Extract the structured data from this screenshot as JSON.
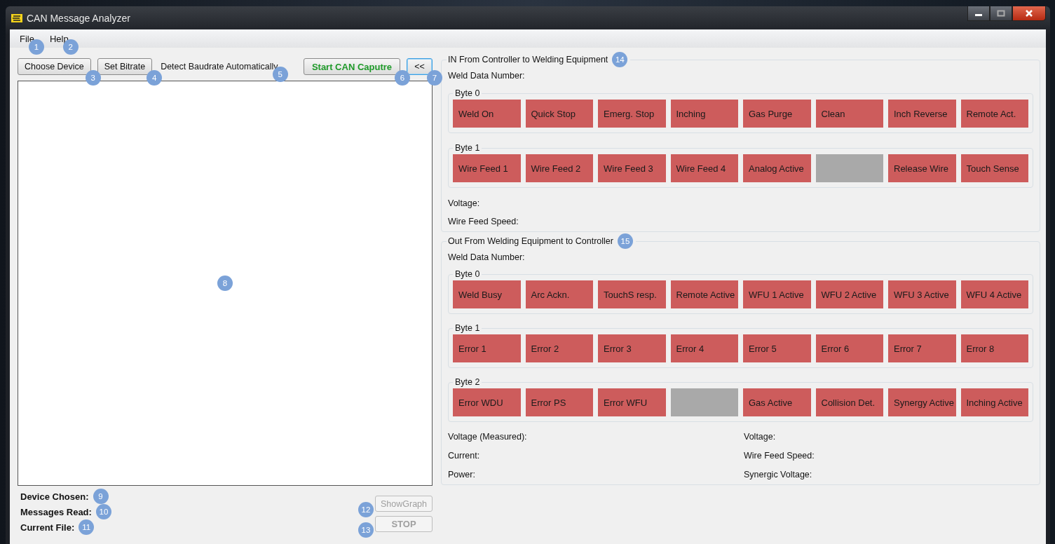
{
  "window": {
    "title": "CAN Message Analyzer"
  },
  "menu": [
    {
      "label": "File",
      "callout": "1"
    },
    {
      "label": "Help",
      "callout": "2"
    }
  ],
  "toolbar": {
    "choose_device": {
      "label": "Choose Device",
      "callout": "3"
    },
    "set_bitrate": {
      "label": "Set Bitrate",
      "callout": "4"
    },
    "detect_baudrate": {
      "text": "Detect Baudrate Automatically",
      "callout": "5"
    },
    "start_capture": {
      "label": "Start CAN Caputre",
      "callout": "6"
    },
    "collapse": {
      "label": "<<",
      "focused": true,
      "callout": "7"
    }
  },
  "message_log": {
    "callout": "8"
  },
  "status": [
    {
      "label": "Device Chosen:",
      "callout": "9"
    },
    {
      "label": "Messages Read:",
      "callout": "10"
    },
    {
      "label": "Current File:",
      "callout": "11"
    }
  ],
  "bottom_buttons": [
    {
      "label": "ShowGraph",
      "disabled": true,
      "bold": false,
      "callout": "12"
    },
    {
      "label": "STOP",
      "disabled": true,
      "bold": true,
      "callout": "13"
    }
  ],
  "in_group": {
    "title": "IN From Controller to Welding Equipment",
    "callout": "14",
    "fields_top": [
      "Weld Data Number:"
    ],
    "bytes": [
      {
        "title": "Byte 0",
        "bits": [
          {
            "kind": "flag",
            "label": "Weld On"
          },
          {
            "kind": "flag",
            "label": "Quick Stop"
          },
          {
            "kind": "flag",
            "label": "Emerg. Stop"
          },
          {
            "kind": "flag",
            "label": "Inching"
          },
          {
            "kind": "flag",
            "label": "Gas Purge"
          },
          {
            "kind": "flag",
            "label": "Clean"
          },
          {
            "kind": "flag",
            "label": "Inch Reverse"
          },
          {
            "kind": "flag",
            "label": "Remote Act."
          }
        ]
      },
      {
        "title": "Byte 1",
        "bits": [
          {
            "kind": "flag",
            "label": "Wire Feed 1"
          },
          {
            "kind": "flag",
            "label": "Wire Feed 2"
          },
          {
            "kind": "flag",
            "label": "Wire Feed 3"
          },
          {
            "kind": "flag",
            "label": "Wire Feed 4"
          },
          {
            "kind": "flag",
            "label": "Analog Active"
          },
          {
            "kind": "unused"
          },
          {
            "kind": "flag",
            "label": "Release Wire"
          },
          {
            "kind": "flag",
            "label": "Touch Sense"
          }
        ]
      }
    ],
    "fields_bottom": [
      "Voltage:",
      "Wire Feed Speed:"
    ]
  },
  "out_group": {
    "title": "Out From Welding Equipment to Controller",
    "callout": "15",
    "fields_top": [
      "Weld Data Number:"
    ],
    "bytes": [
      {
        "title": "Byte 0",
        "bits": [
          {
            "kind": "flag",
            "label": "Weld Busy"
          },
          {
            "kind": "flag",
            "label": "Arc Ackn."
          },
          {
            "kind": "flag",
            "label": "TouchS resp."
          },
          {
            "kind": "flag",
            "label": "Remote Active"
          },
          {
            "kind": "flag",
            "label": "WFU 1 Active"
          },
          {
            "kind": "flag",
            "label": "WFU 2 Active"
          },
          {
            "kind": "flag",
            "label": "WFU 3 Active"
          },
          {
            "kind": "flag",
            "label": "WFU 4 Active"
          }
        ]
      },
      {
        "title": "Byte 1",
        "bits": [
          {
            "kind": "flag",
            "label": "Error 1"
          },
          {
            "kind": "flag",
            "label": "Error 2"
          },
          {
            "kind": "flag",
            "label": "Error 3"
          },
          {
            "kind": "flag",
            "label": "Error 4"
          },
          {
            "kind": "flag",
            "label": "Error 5"
          },
          {
            "kind": "flag",
            "label": "Error 6"
          },
          {
            "kind": "flag",
            "label": "Error 7"
          },
          {
            "kind": "flag",
            "label": "Error 8"
          }
        ]
      },
      {
        "title": "Byte 2",
        "bits": [
          {
            "kind": "flag",
            "label": "Error WDU"
          },
          {
            "kind": "flag",
            "label": "Error PS"
          },
          {
            "kind": "flag",
            "label": "Error WFU"
          },
          {
            "kind": "unused"
          },
          {
            "kind": "flag",
            "label": "Gas Active"
          },
          {
            "kind": "flag",
            "label": "Collision Det."
          },
          {
            "kind": "flag",
            "label": "Synergy Active"
          },
          {
            "kind": "flag",
            "label": "Inching Active"
          }
        ]
      }
    ],
    "readings_left": [
      "Voltage (Measured):",
      "Current:",
      "Power:"
    ],
    "readings_right": [
      "Voltage:",
      "Wire Feed Speed:",
      "Synergic Voltage:"
    ]
  }
}
